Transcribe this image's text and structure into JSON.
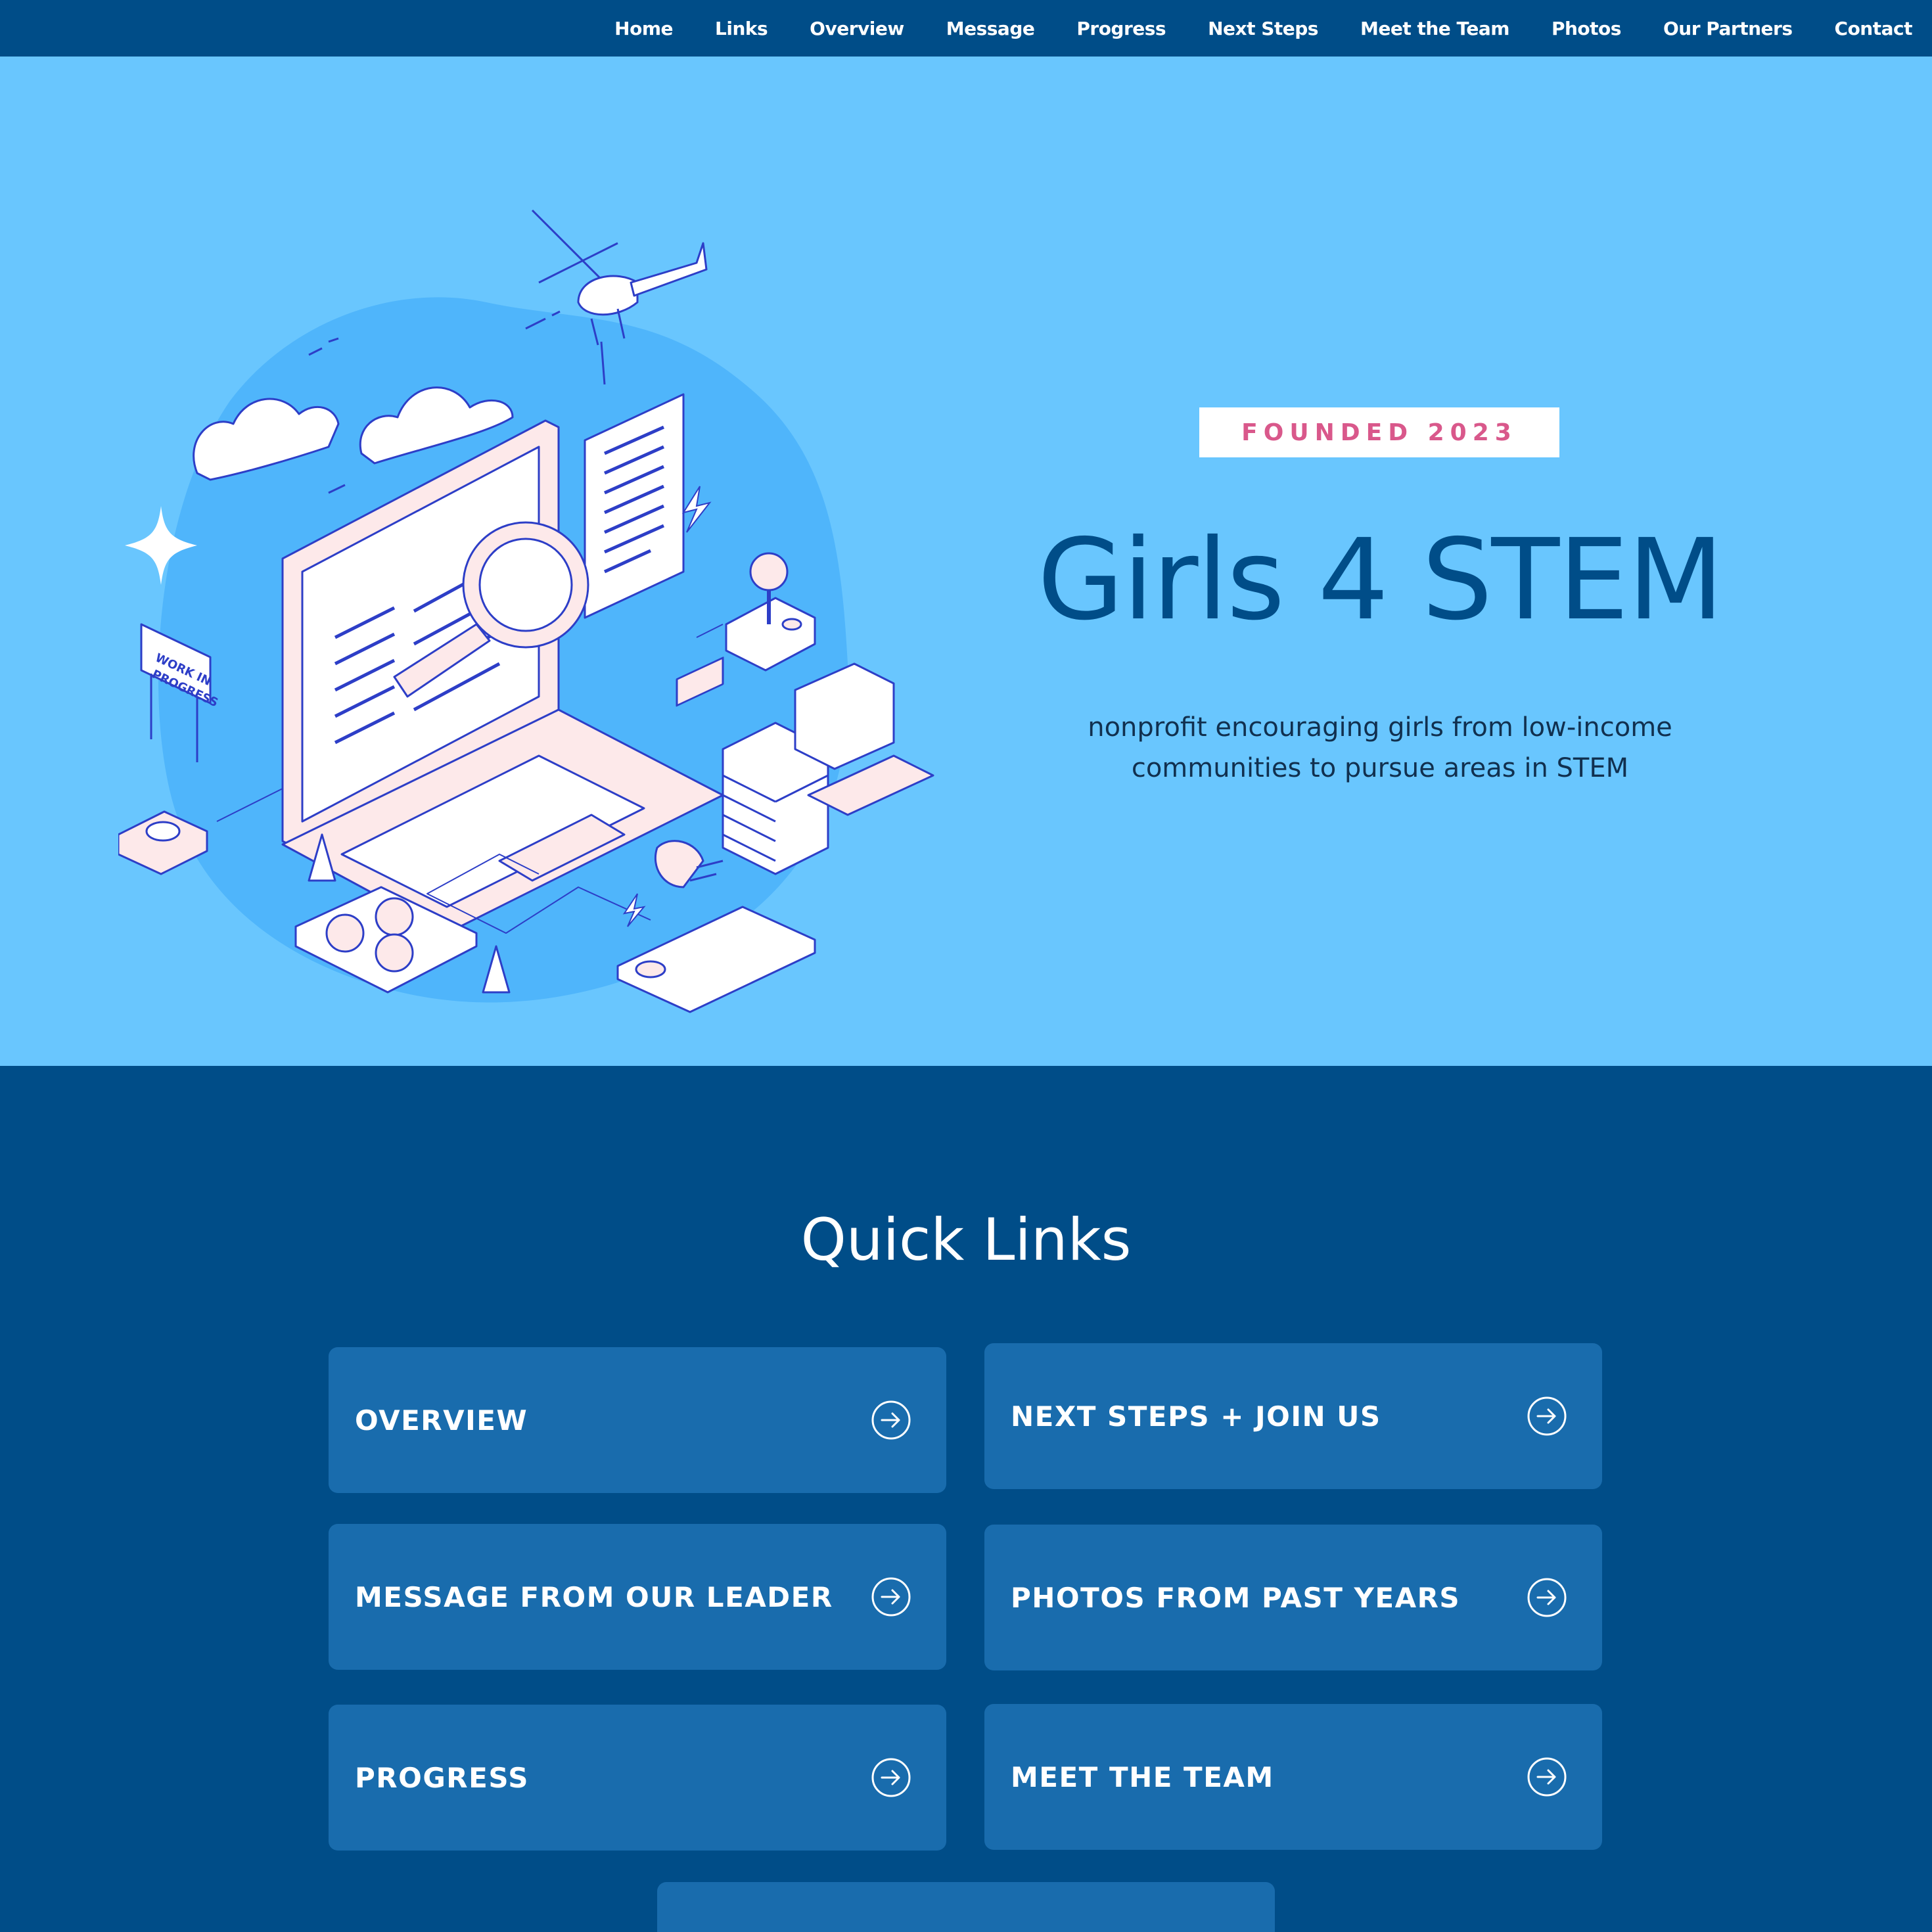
{
  "nav": {
    "items": [
      "Home",
      "Links",
      "Overview",
      "Message",
      "Progress",
      "Next Steps",
      "Meet the Team",
      "Photos",
      "Our Partners",
      "Contact"
    ]
  },
  "hero": {
    "badge": "FOUNDED 2023",
    "title": "Girls 4 STEM",
    "subtitle_line1": "nonprofit encouraging girls from low-income",
    "subtitle_line2": "communities to pursue areas in STEM",
    "sign_text_1": "WORK IN",
    "sign_text_2": "PROGRESS"
  },
  "quick_links": {
    "title": "Quick Links",
    "cards": [
      {
        "label": "OVERVIEW",
        "icon": "arrow-right-circle-icon"
      },
      {
        "label": "NEXT STEPS + JOIN US",
        "icon": "arrow-right-circle-icon"
      },
      {
        "label": "MESSAGE FROM OUR LEADER",
        "icon": "arrow-right-circle-icon"
      },
      {
        "label": "PHOTOS FROM PAST YEARS",
        "icon": "arrow-right-circle-icon"
      },
      {
        "label": "PROGRESS",
        "icon": "arrow-right-circle-icon"
      },
      {
        "label": "MEET THE TEAM",
        "icon": "arrow-right-circle-icon"
      },
      {
        "label": "",
        "icon": ""
      }
    ]
  },
  "colors": {
    "nav_bg": "#004d88",
    "hero_bg": "#69c6fe",
    "card_bg": "#196cad",
    "badge_text": "#d9588b",
    "title_text": "#004d88"
  }
}
